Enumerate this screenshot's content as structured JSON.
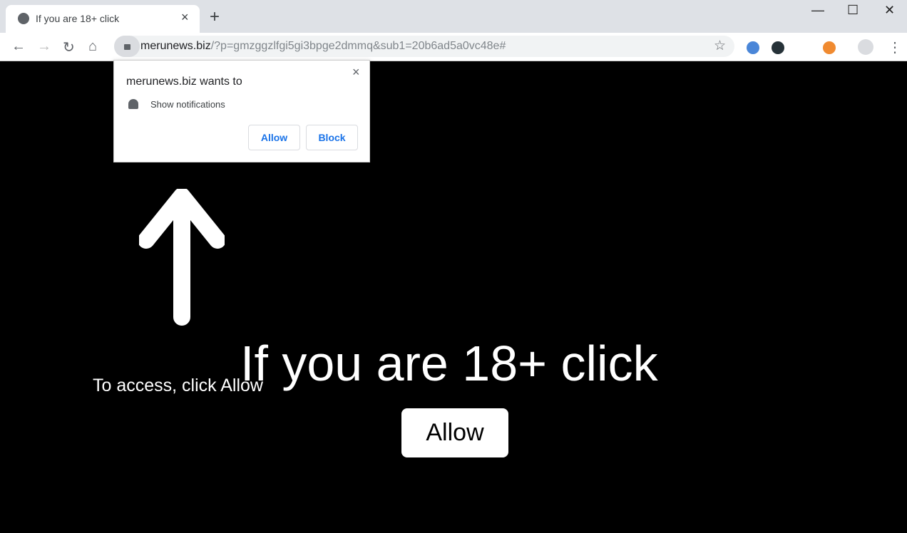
{
  "tab": {
    "title": "If you are 18+ click",
    "close": "×",
    "new": "+"
  },
  "window": {
    "minimize": "—",
    "maximize": "☐",
    "close": "✕"
  },
  "nav": {
    "back": "←",
    "forward": "→",
    "reload": "↻",
    "home": "⌂"
  },
  "address": {
    "domain": "merunews.biz",
    "path": "/?p=gmzggzlfgi5gi3bpge2dmmq&sub1=20b6ad5a0vc48e#"
  },
  "toolbar": {
    "star": "☆",
    "menu": "⋮"
  },
  "extensions": [
    {
      "name": "blue-extension",
      "color": "#4a86d8"
    },
    {
      "name": "a-extension",
      "color": "#263238"
    },
    {
      "name": "bird-extension",
      "color": "#f08a30"
    }
  ],
  "popup": {
    "title": "merunews.biz wants to",
    "permission": "Show notifications",
    "allow": "Allow",
    "block": "Block",
    "close": "×"
  },
  "page": {
    "headline": "If you are 18+ click",
    "access": "To access, click Allow",
    "allow": "Allow"
  }
}
